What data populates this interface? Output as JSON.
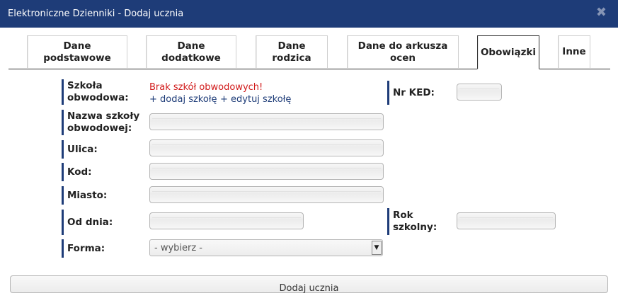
{
  "window": {
    "title": "Elektroniczne Dzienniki - Dodaj ucznia",
    "close_glyph": "✖"
  },
  "tabs": [
    {
      "label": "Dane podstawowe",
      "active": false
    },
    {
      "label": "Dane dodatkowe",
      "active": false
    },
    {
      "label": "Dane rodzica",
      "active": false
    },
    {
      "label": "Dane do arkusza ocen",
      "active": false
    },
    {
      "label": "Obowiązki",
      "active": true
    },
    {
      "label": "Inne",
      "active": false
    }
  ],
  "form": {
    "szkola_label": "Szkoła obwodowa:",
    "szkola_empty": "Brak szkół obwodowych!",
    "add_school_link": "+ dodaj szkołę",
    "edit_school_link": "+ edytuj szkołę",
    "nr_ked_label": "Nr KED:",
    "nr_ked_value": "",
    "nazwa_label": "Nazwa szkoły obwodowej:",
    "nazwa_value": "",
    "ulica_label": "Ulica:",
    "ulica_value": "",
    "kod_label": "Kod:",
    "kod_value": "",
    "miasto_label": "Miasto:",
    "miasto_value": "",
    "od_dnia_label": "Od dnia:",
    "od_dnia_value": "",
    "rok_label": "Rok szkolny:",
    "rok_value": "",
    "forma_label": "Forma:",
    "forma_selected": "- wybierz -"
  },
  "submit_label": "Dodaj ucznia",
  "colors": {
    "titlebar": "#1e3c78",
    "accent": "#1e3c78",
    "error": "#d11a1a"
  }
}
